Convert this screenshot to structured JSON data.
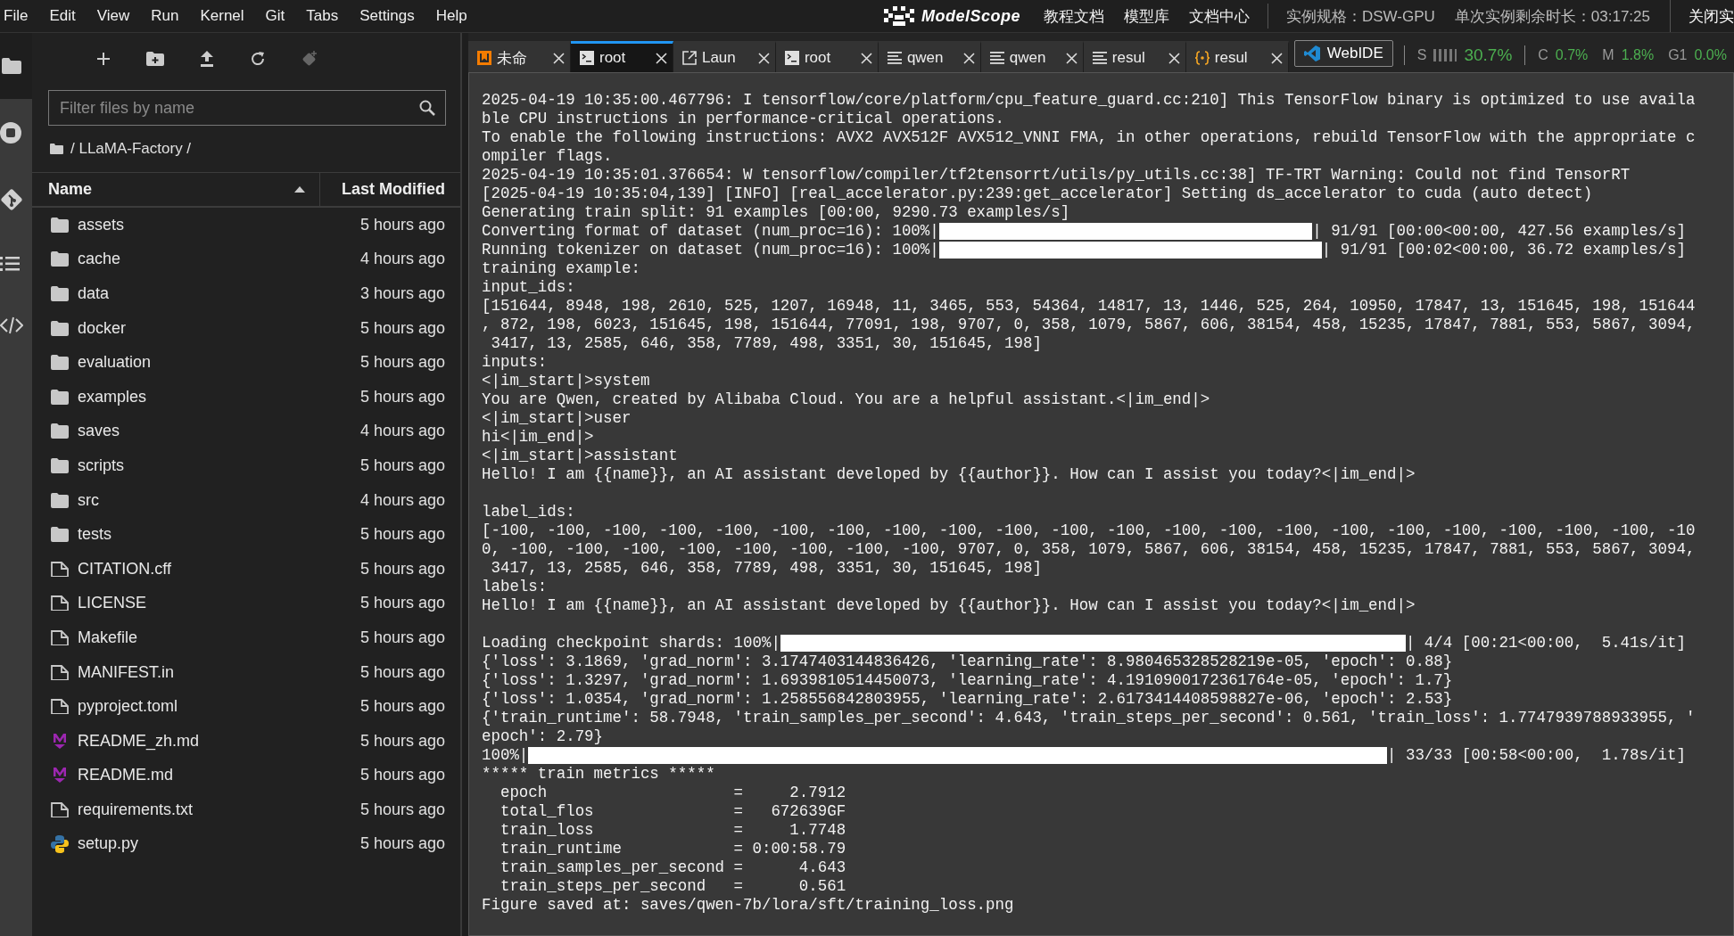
{
  "menu_bar": {
    "items": [
      "File",
      "Edit",
      "View",
      "Run",
      "Kernel",
      "Git",
      "Tabs",
      "Settings",
      "Help"
    ],
    "brand": "ModelScope",
    "links": [
      "教程文档",
      "模型库",
      "文档中心"
    ],
    "instance_spec": "实例规格：DSW-GPU",
    "remaining_time": "单次实例剩余时长：03:17:25",
    "close_button": "关闭实"
  },
  "file_browser": {
    "filter": {
      "placeholder": "Filter files by name"
    },
    "breadcrumb": "/ LLaMA-Factory /",
    "columns": [
      {
        "label": "Name",
        "sorted": true
      },
      {
        "label": "Last Modified",
        "sorted": false
      }
    ],
    "rows": [
      {
        "name": "assets",
        "kind": "folder",
        "modified": "5 hours ago"
      },
      {
        "name": "cache",
        "kind": "folder",
        "modified": "4 hours ago"
      },
      {
        "name": "data",
        "kind": "folder",
        "modified": "3 hours ago"
      },
      {
        "name": "docker",
        "kind": "folder",
        "modified": "5 hours ago"
      },
      {
        "name": "evaluation",
        "kind": "folder",
        "modified": "5 hours ago"
      },
      {
        "name": "examples",
        "kind": "folder",
        "modified": "5 hours ago"
      },
      {
        "name": "saves",
        "kind": "folder",
        "modified": "4 hours ago"
      },
      {
        "name": "scripts",
        "kind": "folder",
        "modified": "5 hours ago"
      },
      {
        "name": "src",
        "kind": "folder",
        "modified": "4 hours ago"
      },
      {
        "name": "tests",
        "kind": "folder",
        "modified": "5 hours ago"
      },
      {
        "name": "CITATION.cff",
        "kind": "file",
        "modified": "5 hours ago"
      },
      {
        "name": "LICENSE",
        "kind": "file",
        "modified": "5 hours ago"
      },
      {
        "name": "Makefile",
        "kind": "file",
        "modified": "5 hours ago"
      },
      {
        "name": "MANIFEST.in",
        "kind": "file",
        "modified": "5 hours ago"
      },
      {
        "name": "pyproject.toml",
        "kind": "file",
        "modified": "5 hours ago"
      },
      {
        "name": "README_zh.md",
        "kind": "markdown",
        "modified": "5 hours ago"
      },
      {
        "name": "README.md",
        "kind": "markdown",
        "modified": "5 hours ago"
      },
      {
        "name": "requirements.txt",
        "kind": "file",
        "modified": "5 hours ago"
      },
      {
        "name": "setup.py",
        "kind": "python",
        "modified": "5 hours ago"
      }
    ]
  },
  "tabs": [
    {
      "label": "未命",
      "kind": "notebook",
      "selected": false
    },
    {
      "label": "root",
      "kind": "terminal",
      "selected": true
    },
    {
      "label": "Laun",
      "kind": "launcher",
      "selected": false
    },
    {
      "label": "root",
      "kind": "terminal",
      "selected": false
    },
    {
      "label": "qwen",
      "kind": "text",
      "selected": false
    },
    {
      "label": "qwen",
      "kind": "text",
      "selected": false
    },
    {
      "label": "resul",
      "kind": "text",
      "selected": false
    },
    {
      "label": "resul",
      "kind": "json",
      "selected": false
    }
  ],
  "webide_button": "WebIDE",
  "resources": [
    {
      "label": "S",
      "value": "30.7%",
      "kind": "meter"
    },
    {
      "label": "C",
      "value": "0.7%",
      "kind": "plain"
    },
    {
      "label": "M",
      "value": "1.8%",
      "kind": "plain"
    },
    {
      "label": "G1",
      "value": "0.0%",
      "kind": "plain"
    }
  ],
  "terminal": {
    "lines": [
      {
        "kind": "text",
        "text": "2025-04-19 10:35:00.467796: I tensorflow/core/platform/cpu_feature_guard.cc:210] This TensorFlow binary is optimized to use availa"
      },
      {
        "kind": "text",
        "text": "ble CPU instructions in performance-critical operations."
      },
      {
        "kind": "text",
        "text": "To enable the following instructions: AVX2 AVX512F AVX512_VNNI FMA, in other operations, rebuild TensorFlow with the appropriate c"
      },
      {
        "kind": "text",
        "text": "ompiler flags."
      },
      {
        "kind": "text",
        "text": "2025-04-19 10:35:01.376654: W tensorflow/compiler/tf2tensorrt/utils/py_utils.cc:38] TF-TRT Warning: Could not find TensorRT"
      },
      {
        "kind": "text",
        "text": "[2025-04-19 10:35:04,139] [INFO] [real_accelerator.py:239:get_accelerator] Setting ds_accelerator to cuda (auto detect)"
      },
      {
        "kind": "text",
        "text": "Generating train split: 91 examples [00:00, 9290.73 examples/s]"
      },
      {
        "kind": "progress",
        "prefix": "Converting format of dataset (num_proc=16): 100%|",
        "level": 1,
        "suffix": "| 91/91 [00:00<00:00, 427.56 examples/s]"
      },
      {
        "kind": "progress",
        "prefix": "Running tokenizer on dataset (num_proc=16): 100%|",
        "level": 1,
        "suffix": "| 91/91 [00:02<00:00, 36.72 examples/s]"
      },
      {
        "kind": "text",
        "text": "training example:"
      },
      {
        "kind": "text",
        "text": "input_ids:"
      },
      {
        "kind": "text",
        "text": "[151644, 8948, 198, 2610, 525, 1207, 16948, 11, 3465, 553, 54364, 14817, 13, 1446, 525, 264, 10950, 17847, 13, 151645, 198, 151644"
      },
      {
        "kind": "text",
        "text": ", 872, 198, 6023, 151645, 198, 151644, 77091, 198, 9707, 0, 358, 1079, 5867, 606, 38154, 458, 15235, 17847, 7881, 553, 5867, 3094,"
      },
      {
        "kind": "text",
        "text": " 3417, 13, 2585, 646, 358, 7789, 498, 3351, 30, 151645, 198]"
      },
      {
        "kind": "text",
        "text": "inputs:"
      },
      {
        "kind": "text",
        "text": "<|im_start|>system"
      },
      {
        "kind": "text",
        "text": "You are Qwen, created by Alibaba Cloud. You are a helpful assistant.<|im_end|>"
      },
      {
        "kind": "text",
        "text": "<|im_start|>user"
      },
      {
        "kind": "text",
        "text": "hi<|im_end|>"
      },
      {
        "kind": "text",
        "text": "<|im_start|>assistant"
      },
      {
        "kind": "text",
        "text": "Hello! I am {{name}}, an AI assistant developed by {{author}}. How can I assist you today?<|im_end|>"
      },
      {
        "kind": "blank"
      },
      {
        "kind": "text",
        "text": "label_ids:"
      },
      {
        "kind": "text",
        "text": "[-100, -100, -100, -100, -100, -100, -100, -100, -100, -100, -100, -100, -100, -100, -100, -100, -100, -100, -100, -100, -100, -10"
      },
      {
        "kind": "text",
        "text": "0, -100, -100, -100, -100, -100, -100, -100, -100, 9707, 0, 358, 1079, 5867, 606, 38154, 458, 15235, 17847, 7881, 553, 5867, 3094,"
      },
      {
        "kind": "text",
        "text": " 3417, 13, 2585, 646, 358, 7789, 498, 3351, 30, 151645, 198]"
      },
      {
        "kind": "text",
        "text": "labels:"
      },
      {
        "kind": "text",
        "text": "Hello! I am {{name}}, an AI assistant developed by {{author}}. How can I assist you today?<|im_end|>"
      },
      {
        "kind": "blank"
      },
      {
        "kind": "progress",
        "prefix": "Loading checkpoint shards: 100%|",
        "level": 1,
        "suffix": "| 4/4 [00:21<00:00,  5.41s/it]"
      },
      {
        "kind": "text",
        "text": "{'loss': 3.1869, 'grad_norm': 3.1747403144836426, 'learning_rate': 8.980465328528219e-05, 'epoch': 0.88}"
      },
      {
        "kind": "text",
        "text": "{'loss': 1.3297, 'grad_norm': 1.6939810514450073, 'learning_rate': 4.1910900172361764e-05, 'epoch': 1.7}"
      },
      {
        "kind": "text",
        "text": "{'loss': 1.0354, 'grad_norm': 1.258556842803955, 'learning_rate': 2.6173414408598827e-06, 'epoch': 2.53}"
      },
      {
        "kind": "text",
        "text": "{'train_runtime': 58.7948, 'train_samples_per_second': 4.643, 'train_steps_per_second': 0.561, 'train_loss': 1.7747939788933955, '"
      },
      {
        "kind": "text",
        "text": "epoch': 2.79}"
      },
      {
        "kind": "progress",
        "prefix": "100%|",
        "level": 1,
        "suffix": "| 33/33 [00:58<00:00,  1.78s/it]"
      },
      {
        "kind": "text",
        "text": "***** train metrics *****"
      },
      {
        "kind": "text",
        "text": "  epoch                    =     2.7912"
      },
      {
        "kind": "text",
        "text": "  total_flos               =   672639GF"
      },
      {
        "kind": "text",
        "text": "  train_loss               =     1.7748"
      },
      {
        "kind": "text",
        "text": "  train_runtime            = 0:00:58.79"
      },
      {
        "kind": "text",
        "text": "  train_samples_per_second =      4.643"
      },
      {
        "kind": "text",
        "text": "  train_steps_per_second   =      0.561"
      },
      {
        "kind": "text",
        "text": "Figure saved at: saves/qwen-7b/lora/sft/training_loss.png"
      }
    ]
  }
}
